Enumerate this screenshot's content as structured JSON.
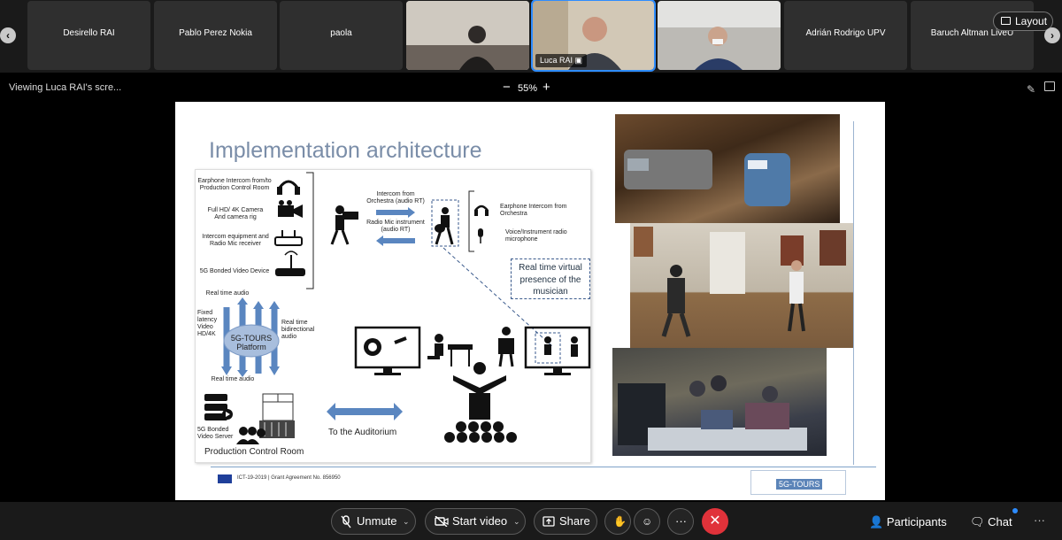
{
  "participants": [
    {
      "name": "Desirello RAI",
      "type": "name"
    },
    {
      "name": "Pablo Perez Nokia",
      "type": "name"
    },
    {
      "name": "paola",
      "type": "name"
    },
    {
      "name": "",
      "type": "video"
    },
    {
      "name": "Luca RAI",
      "type": "video",
      "active": true,
      "sharing": true
    },
    {
      "name": "",
      "type": "video"
    },
    {
      "name": "Adrián Rodrigo UPV",
      "type": "name"
    },
    {
      "name": "Baruch Altman LiveU",
      "type": "name"
    }
  ],
  "strip": {
    "layout_label": "Layout",
    "nav_left": "‹",
    "nav_right": "›"
  },
  "viewbar": {
    "viewing": "Viewing Luca RAI's scre...",
    "zoom": "55%",
    "zoom_minus": "−",
    "zoom_plus": "+"
  },
  "slide": {
    "title": "Implementation architecture",
    "labels": {
      "earphone_intercom_pcr": "Earphone Intercom from/to Production Control Room",
      "camera": "Full HD/ 4K Camera And camera rig",
      "intercom_equipment": "Intercom equipment and Radio Mic receiver",
      "bonded_device": "5G Bonded Video Device",
      "intercom_orchestra_arrow": "Intercom from Orchestra (audio RT)",
      "radio_mic_arrow": "Radio Mic instrument (audio RT)",
      "earphone_orchestra": "Earphone Intercom from Orchestra",
      "voice_instrument": "Voice/Instrument radio microphone",
      "virtual_presence": "Real time virtual presence of the musician",
      "rt_audio_top": "Real time audio",
      "fixed_latency": "Fixed latency Video HD/4K",
      "platform": "5G-TOURS Platform",
      "rt_bidirectional": "Real time bidirectional audio",
      "rt_audio_bottom": "Real time audio",
      "bonded_server": "5G Bonded Video Server",
      "to_auditorium": "To the Auditorium",
      "pcr": "Production Control Room"
    },
    "footer": {
      "grant": "ICT-19-2019 | Grant Agreement No. 856950",
      "logo": "5G-TOURS"
    }
  },
  "controls": {
    "mute": "Unmute",
    "video": "Start video",
    "share": "Share",
    "participants": "Participants",
    "chat": "Chat",
    "end": "✕",
    "more": "···",
    "overflow": "···"
  },
  "colors": {
    "accent": "#2d8cff",
    "end": "#e0323a",
    "arrow_blue": "#5a86c0",
    "title": "#7a8da8"
  }
}
